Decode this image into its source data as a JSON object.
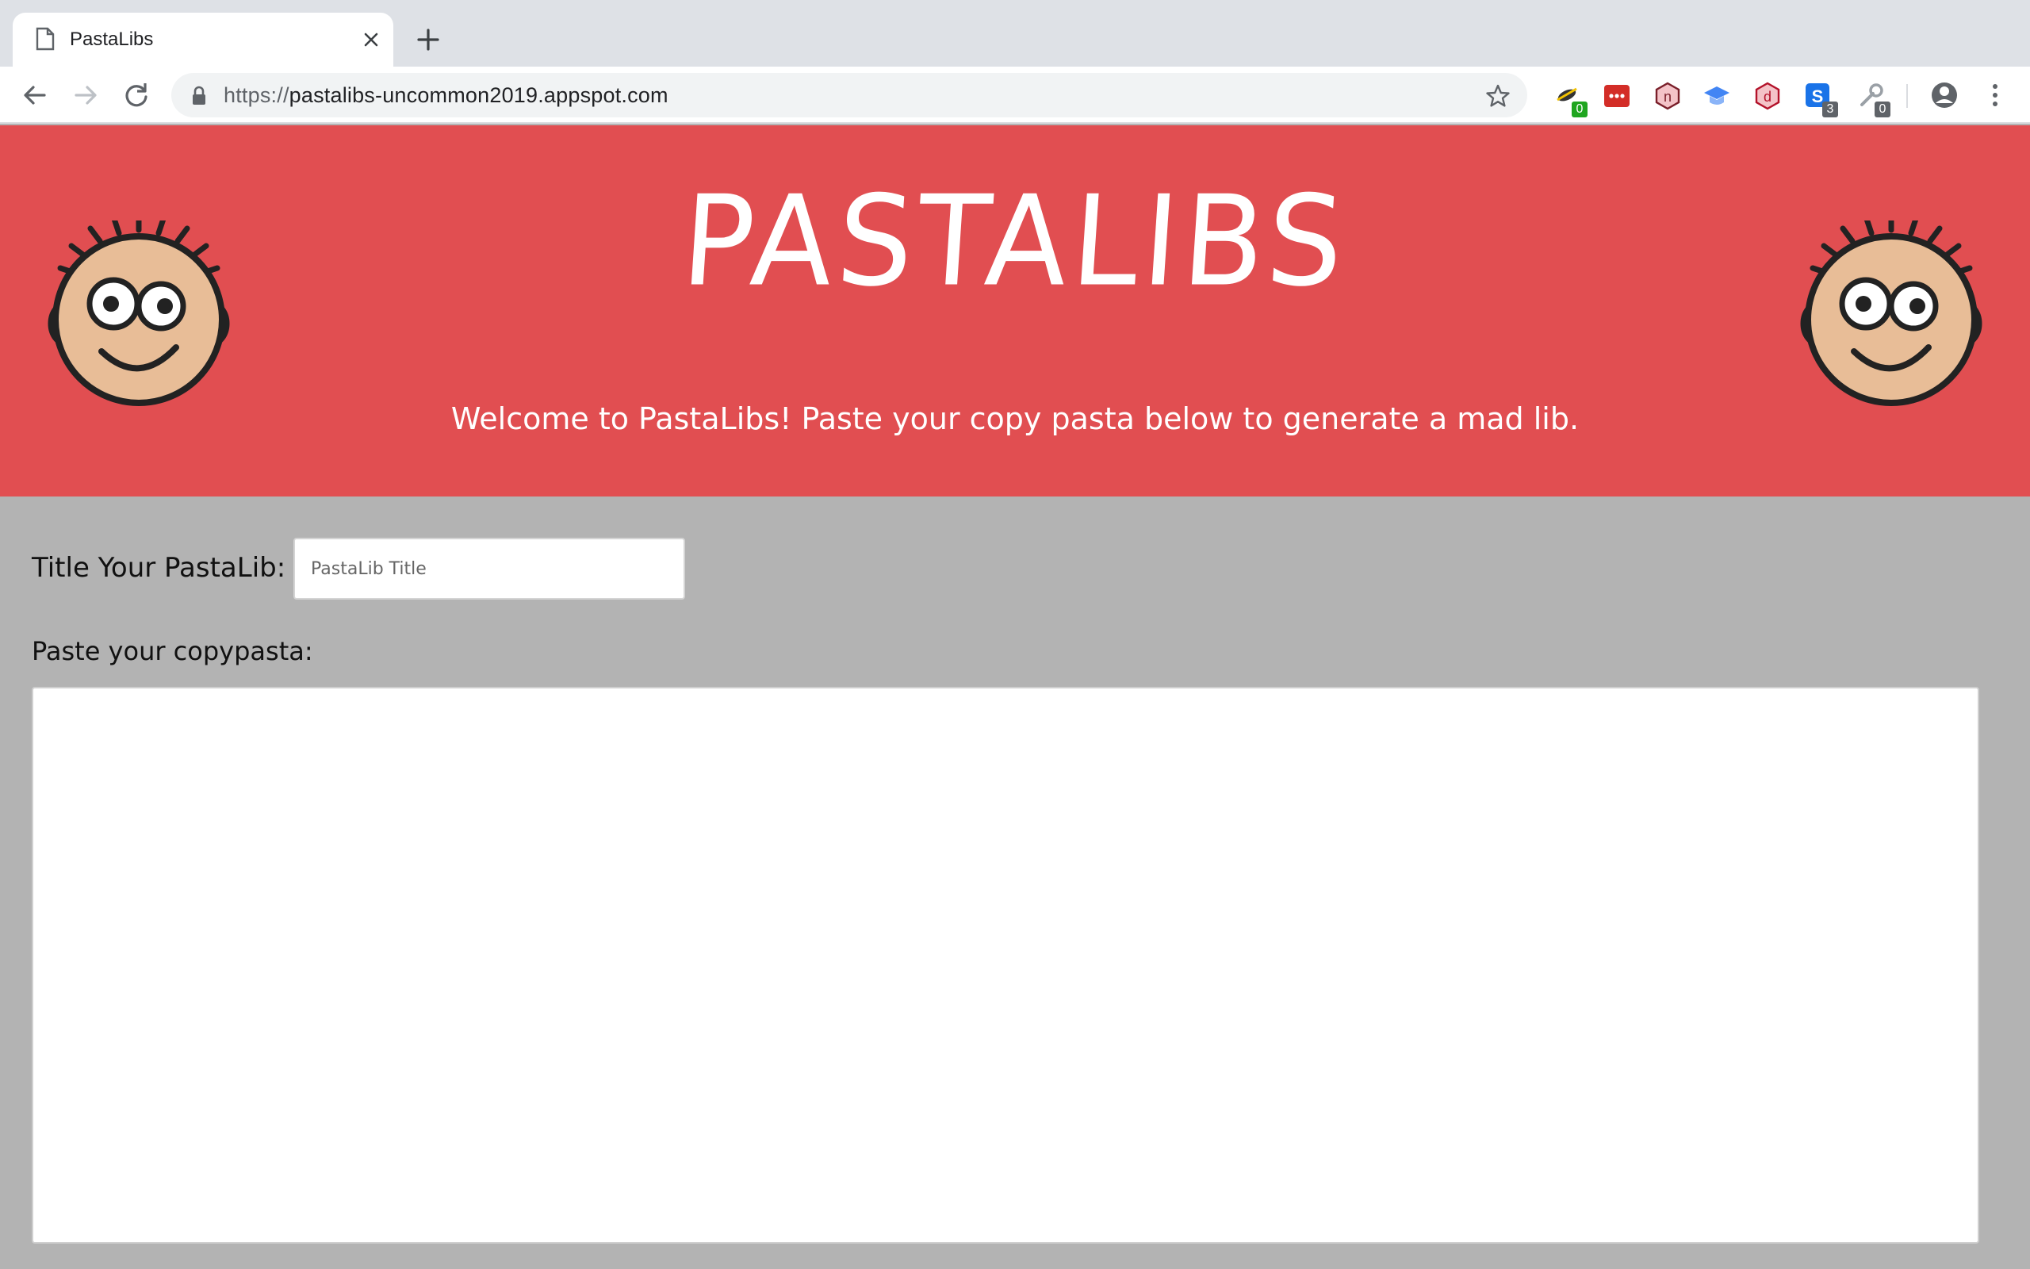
{
  "browser": {
    "tab": {
      "title": "PastaLibs"
    },
    "url": {
      "scheme": "https://",
      "host": "pastalibs-uncommon2019.appspot.com"
    },
    "extensions": [
      {
        "name": "bug-extension-icon",
        "badge": "0",
        "badge_color": "#1fa51f"
      },
      {
        "name": "lastpass-icon",
        "badge": null
      },
      {
        "name": "n-extension-icon",
        "badge": null
      },
      {
        "name": "graduation-cap-icon",
        "badge": null
      },
      {
        "name": "d-extension-icon",
        "badge": null
      },
      {
        "name": "s-extension-icon",
        "badge": "3",
        "badge_color": "#5f6368"
      },
      {
        "name": "puzzle-extension-icon",
        "badge": "0",
        "badge_color": "#5f6368"
      }
    ]
  },
  "header": {
    "title": "PASTALIBS",
    "welcome": "Welcome to PastaLibs! Paste your copy pasta below to generate a mad lib.",
    "background": "#e14e51"
  },
  "form": {
    "title_label": "Title Your PastaLib:",
    "title_placeholder": "PastaLib Title",
    "copy_label": "Paste your copypasta:",
    "copy_value": ""
  }
}
